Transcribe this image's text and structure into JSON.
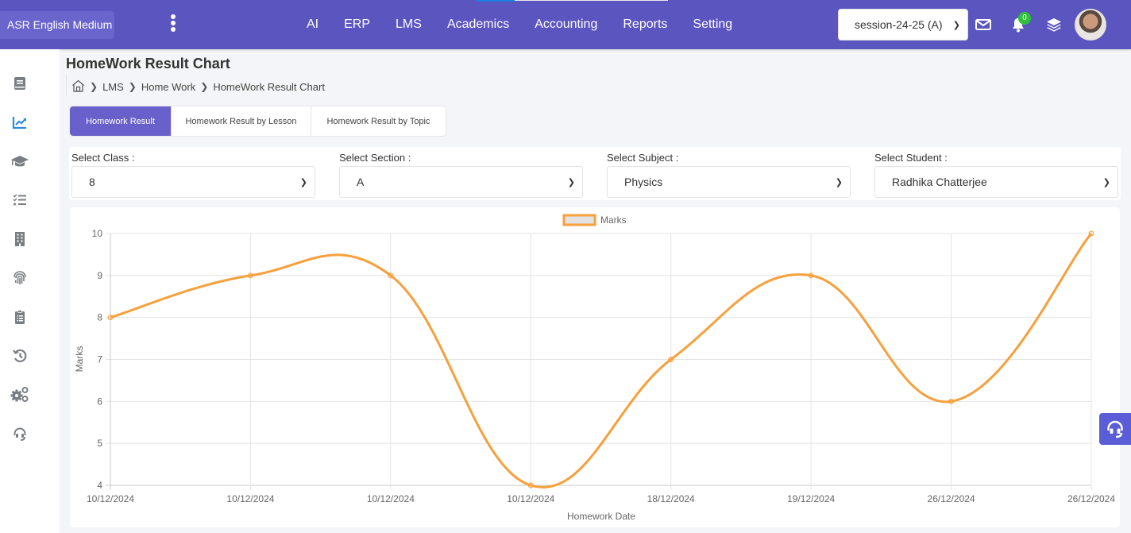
{
  "header": {
    "brand": "ASR English Medium",
    "nav": [
      "AI",
      "ERP",
      "LMS",
      "Academics",
      "Accounting",
      "Reports",
      "Setting"
    ],
    "session": "session-24-25 (A)",
    "notification_count": "0",
    "icons": [
      "kebab-menu-icon",
      "mail-icon",
      "bell-icon",
      "layers-icon",
      "avatar"
    ],
    "colors": {
      "bar": "#5b55c0",
      "badge": "#2ec23a"
    }
  },
  "sidebar": {
    "items": [
      {
        "icon": "book-icon",
        "active": false
      },
      {
        "icon": "chart-line-icon",
        "active": true
      },
      {
        "icon": "graduation-cap-icon",
        "active": false
      },
      {
        "icon": "checklist-icon",
        "active": false
      },
      {
        "icon": "building-icon",
        "active": false
      },
      {
        "icon": "fingerprint-icon",
        "active": false
      },
      {
        "icon": "clipboard-list-icon",
        "active": false
      },
      {
        "icon": "history-icon",
        "active": false
      },
      {
        "icon": "gears-icon",
        "active": false
      },
      {
        "icon": "headset-icon",
        "active": false
      }
    ],
    "colors": {
      "active": "#2a8be0",
      "inactive": "#7a7e83"
    }
  },
  "page": {
    "title": "HomeWork Result Chart",
    "breadcrumb": [
      "LMS",
      "Home Work",
      "HomeWork Result Chart"
    ]
  },
  "tabs": [
    {
      "label": "Homework Result",
      "active": true
    },
    {
      "label": "Homework Result by Lesson",
      "active": false
    },
    {
      "label": "Homework Result by Topic",
      "active": false
    }
  ],
  "filters": [
    {
      "label": "Select Class :",
      "value": "8"
    },
    {
      "label": "Select Section :",
      "value": "A"
    },
    {
      "label": "Select Subject :",
      "value": "Physics"
    },
    {
      "label": "Select Student :",
      "value": "Radhika Chatterjee"
    }
  ],
  "chart_data": {
    "type": "line",
    "title": "",
    "categories": [
      "10/12/2024",
      "10/12/2024",
      "10/12/2024",
      "10/12/2024",
      "18/12/2024",
      "19/12/2024",
      "26/12/2024",
      "26/12/2024"
    ],
    "series": [
      {
        "name": "Marks",
        "values": [
          8,
          9,
          9,
          4,
          7,
          9,
          6,
          10
        ],
        "color": "#f7a03c",
        "legend_fill": "#e3e3e3"
      }
    ],
    "xlabel": "Homework Date",
    "ylabel": "Marks",
    "ylim": [
      4,
      10
    ],
    "yticks": [
      4,
      5,
      6,
      7,
      8,
      9,
      10
    ],
    "grid": true,
    "legend": "top-center",
    "curve": "smooth"
  },
  "help_button": {
    "icon": "headset-icon"
  }
}
